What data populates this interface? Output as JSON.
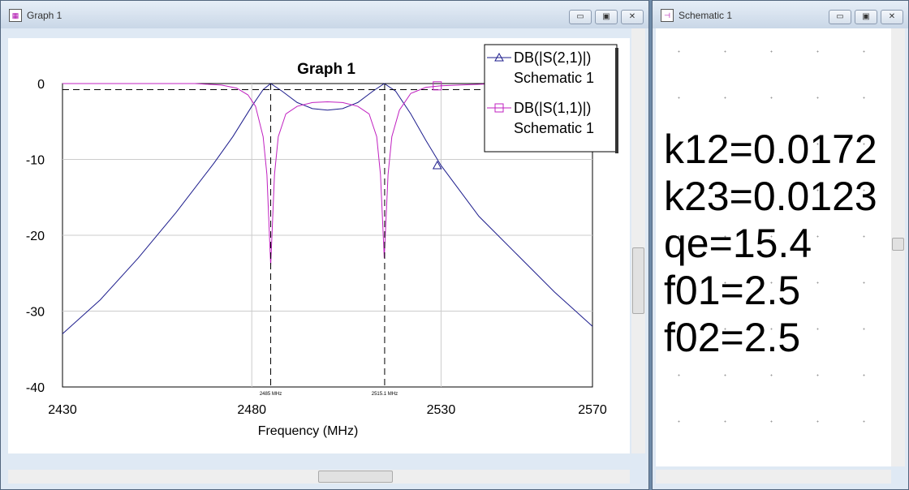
{
  "graph_window": {
    "title": "Graph 1",
    "buttons": [
      "minimize",
      "maximize",
      "close"
    ]
  },
  "schematic_window": {
    "title": "Schematic 1",
    "params": [
      "k12=0.0172",
      "k23=0.0123",
      "qe=15.4",
      "f01=2.5",
      "f02=2.5"
    ]
  },
  "colors": {
    "s21": "#1c1c8c",
    "s11": "#c020c0"
  },
  "chart_data": {
    "type": "line",
    "title": "Graph 1",
    "xlabel": "Frequency (MHz)",
    "ylabel": "",
    "xlim": [
      2430,
      2570
    ],
    "ylim": [
      -40,
      0
    ],
    "xticks": [
      "2430",
      "2480",
      "2530",
      "2570"
    ],
    "yticks": [
      "0",
      "-10",
      "-20",
      "-30",
      "-40"
    ],
    "legend": {
      "placement": "top-right",
      "entries": [
        {
          "label": "DB(|S(2,1)|)",
          "sub": "Schematic 1",
          "marker": "triangle"
        },
        {
          "label": "DB(|S(1,1)|)",
          "sub": "Schematic 1",
          "marker": "square"
        }
      ]
    },
    "markers": [
      {
        "x": 2485,
        "label": "2485 MHz"
      },
      {
        "x": 2515.1,
        "label": "2515.1 MHz"
      }
    ],
    "series": [
      {
        "name": "DB(|S(2,1)|)",
        "x": [
          2430,
          2440,
          2450,
          2460,
          2470,
          2475,
          2480,
          2483,
          2485,
          2488,
          2492,
          2496,
          2500,
          2504,
          2508,
          2512,
          2515,
          2518,
          2522,
          2526,
          2530,
          2540,
          2550,
          2560,
          2570
        ],
        "y": [
          -33,
          -28.5,
          -23,
          -17,
          -10.5,
          -7,
          -3,
          -0.8,
          0,
          -1,
          -2.5,
          -3.3,
          -3.5,
          -3.3,
          -2.5,
          -1,
          0,
          -1,
          -4,
          -7.5,
          -10.8,
          -17.5,
          -22.5,
          -27.5,
          -32
        ]
      },
      {
        "name": "DB(|S(1,1)|)",
        "x": [
          2430,
          2465,
          2472,
          2476,
          2479,
          2481,
          2483,
          2484,
          2485,
          2486,
          2487,
          2489,
          2492,
          2496,
          2500,
          2504,
          2508,
          2511,
          2513,
          2514,
          2515,
          2516,
          2517,
          2519,
          2522,
          2526,
          2530,
          2545,
          2570
        ],
        "y": [
          0,
          0,
          -0.2,
          -0.6,
          -1.5,
          -3,
          -7,
          -12,
          -24,
          -12,
          -7,
          -4,
          -3,
          -2.5,
          -2.4,
          -2.5,
          -3,
          -4,
          -7,
          -12,
          -23,
          -12,
          -7,
          -3.5,
          -1.3,
          -0.5,
          -0.3,
          0,
          0
        ]
      }
    ]
  }
}
